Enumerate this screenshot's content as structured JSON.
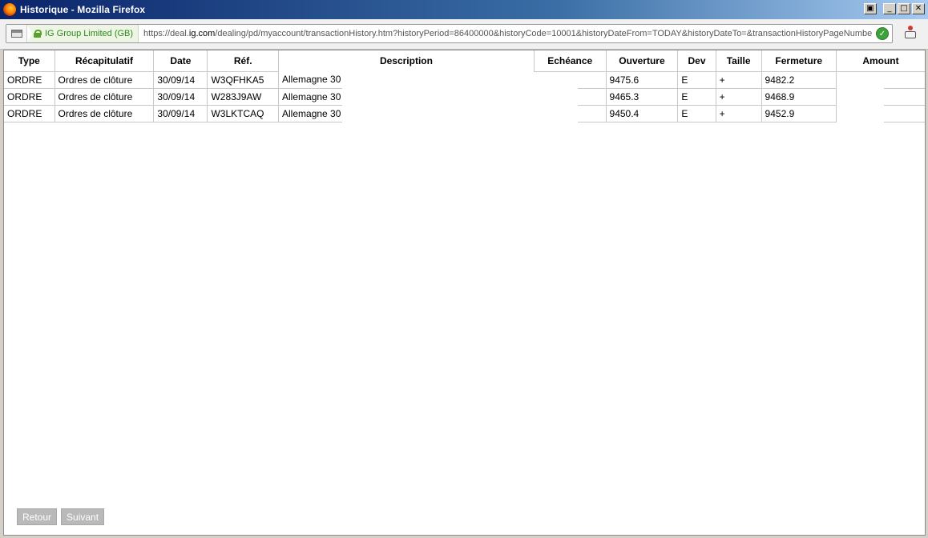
{
  "window": {
    "title": "Historique - Mozilla Firefox",
    "buttons": {
      "restore": "▣",
      "minimize": "_",
      "maximize": "□",
      "close": "✕"
    }
  },
  "addressbar": {
    "identity": "IG Group Limited (GB)",
    "url_prefix": "https://deal.",
    "url_domain": "ig.com",
    "url_rest": "/dealing/pd/myaccount/transactionHistory.htm?historyPeriod=86400000&historyCode=10001&historyDateFrom=TODAY&historyDateTo=&transactionHistoryPageNumber",
    "check_glyph": "✓"
  },
  "table": {
    "headers": {
      "type": "Type",
      "recap": "Récapitulatif",
      "date": "Date",
      "ref": "Réf.",
      "description": "Description",
      "echeance": "Echéance",
      "ouverture": "Ouverture",
      "dev": "Dev",
      "taille": "Taille",
      "fermeture": "Fermeture",
      "amount": "Amount"
    },
    "rows": [
      {
        "type": "ORDRE",
        "recap": "Ordres de clôture",
        "date": "30/09/14",
        "ref": "W3QFHKA5",
        "description": "Allemagne 30",
        "ouverture": "9475.6",
        "dev": "E",
        "taille": "+",
        "fermeture": "9482.2"
      },
      {
        "type": "ORDRE",
        "recap": "Ordres de clôture",
        "date": "30/09/14",
        "ref": "W283J9AW",
        "description": "Allemagne 30",
        "ouverture": "9465.3",
        "dev": "E",
        "taille": "+",
        "fermeture": "9468.9"
      },
      {
        "type": "ORDRE",
        "recap": "Ordres de clôture",
        "date": "30/09/14",
        "ref": "W3LKTCAQ",
        "description": "Allemagne 30",
        "ouverture": "9450.4",
        "dev": "E",
        "taille": "+",
        "fermeture": "9452.9"
      }
    ]
  },
  "pager": {
    "prev": "Retour",
    "next": "Suivant"
  }
}
